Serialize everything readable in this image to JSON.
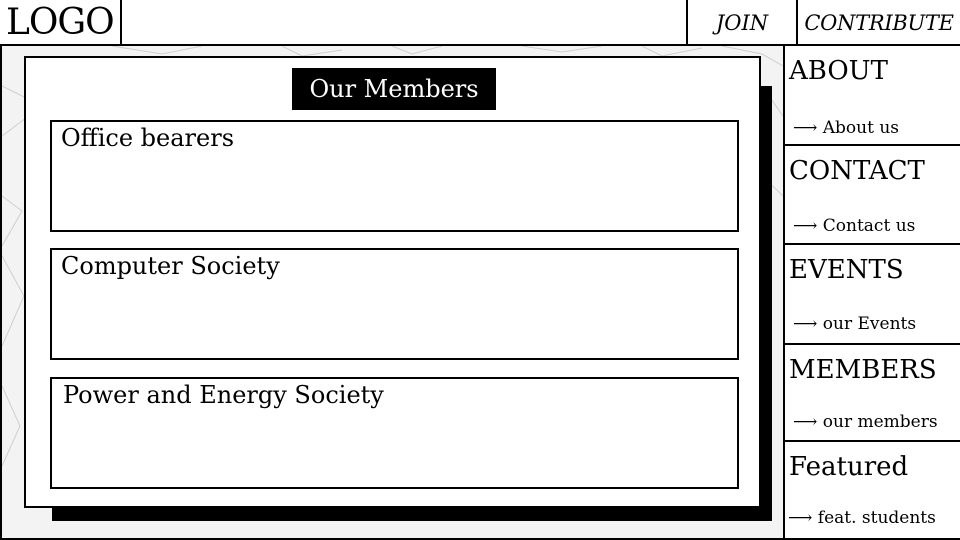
{
  "header": {
    "logo": "LOGO",
    "join": "JOIN",
    "contribute": "CONTRIBUTE"
  },
  "main": {
    "title": "Our Members",
    "sections": [
      {
        "label": "Office bearers"
      },
      {
        "label": "Computer Society"
      },
      {
        "label": "Power and Energy Society"
      }
    ]
  },
  "sidebar": {
    "items": [
      {
        "title": "ABOUT",
        "link": "⟶ About us"
      },
      {
        "title": "CONTACT",
        "link": "⟶ Contact us"
      },
      {
        "title": "EVENTS",
        "link": "⟶ our Events"
      },
      {
        "title": "MEMBERS",
        "link": "⟶ our members"
      },
      {
        "title": "Featured",
        "link": "⟶ feat. students"
      }
    ]
  }
}
